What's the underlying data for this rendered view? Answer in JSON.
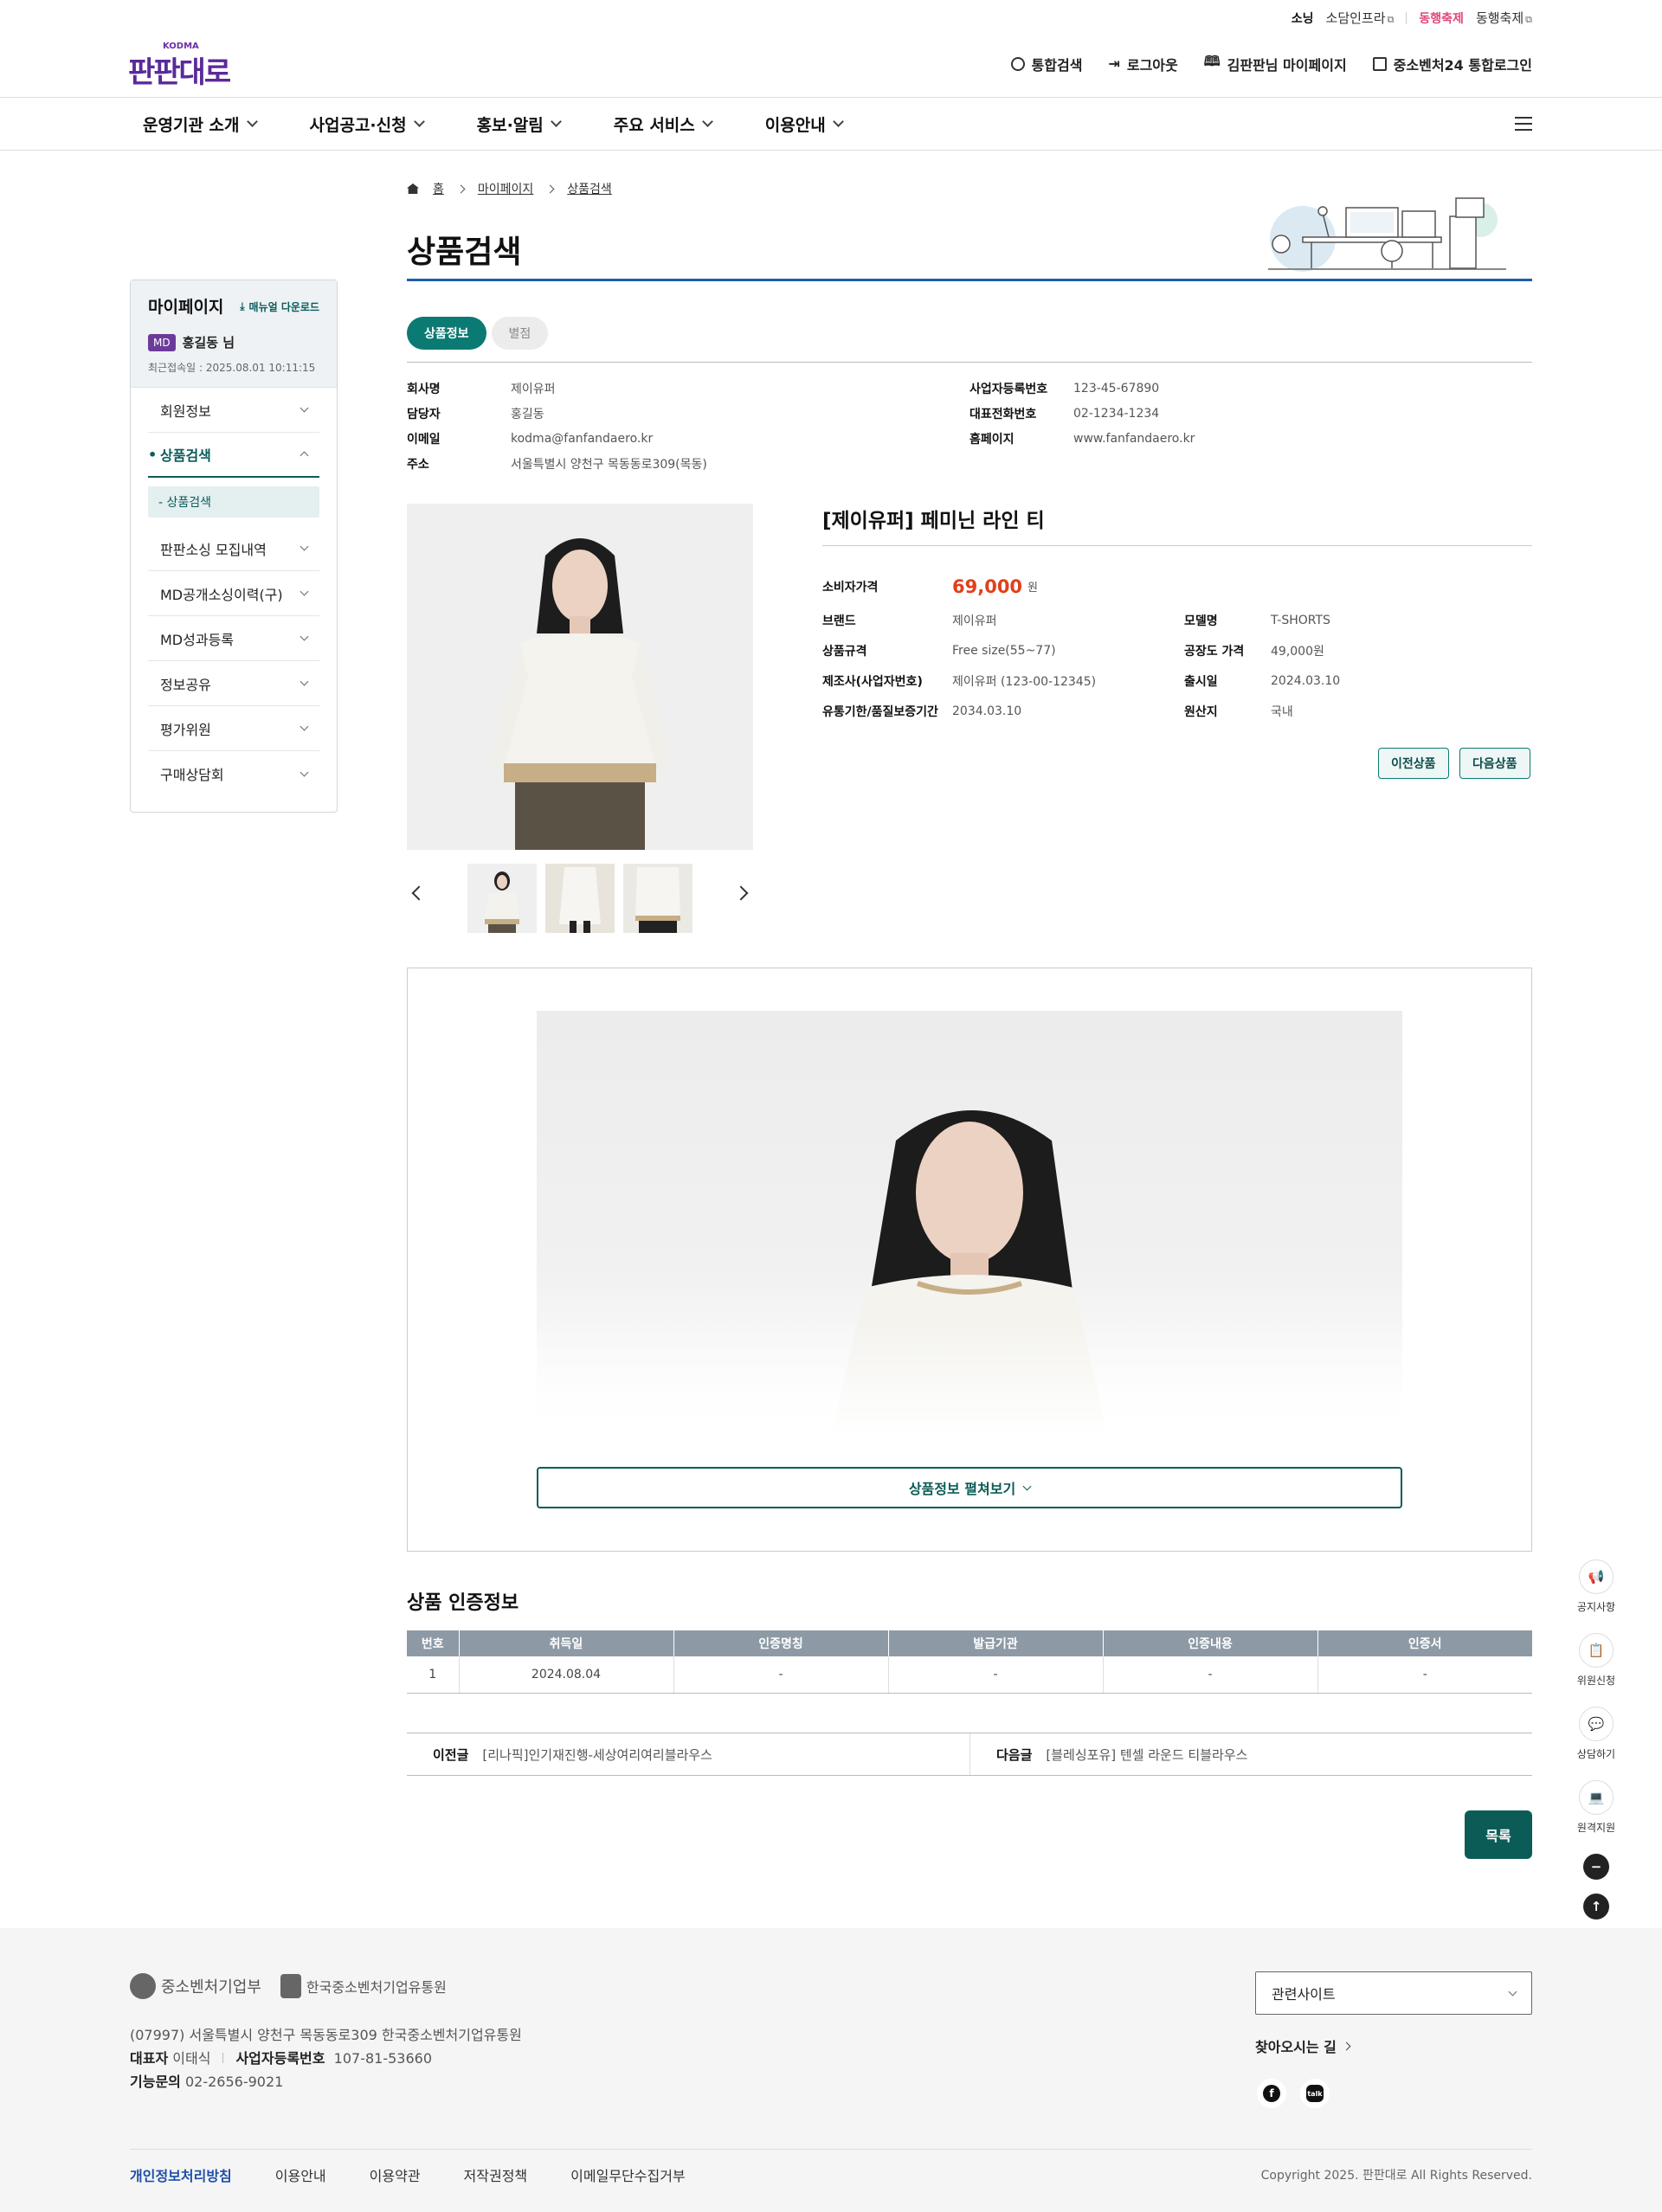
{
  "util_bar": {
    "items": [
      {
        "brand": "소닝",
        "label": "소담인프라"
      },
      {
        "brand": "동행축제",
        "label": "동행축제"
      }
    ]
  },
  "header": {
    "logo_sub": "KODMA",
    "logo_text": "판판대로",
    "util": [
      {
        "icon": "search-icon",
        "label": "통합검색"
      },
      {
        "icon": "logout-icon",
        "label": "로그아웃"
      },
      {
        "icon": "book-icon",
        "label": "김판판님 마이페이지"
      },
      {
        "icon": "doc-icon",
        "label": "중소벤처24 통합로그인"
      }
    ]
  },
  "nav": [
    "운영기관 소개",
    "사업공고·신청",
    "홍보·알림",
    "주요 서비스",
    "이용안내"
  ],
  "sidebar": {
    "title": "마이페이지",
    "manual": "매뉴얼 다운로드",
    "badge": "MD",
    "user": "홍길동 님",
    "last_login": "최근접속일 : 2025.08.01 10:11:15",
    "items": [
      "회원정보",
      "상품검색",
      "판판소싱 모집내역",
      "MD공개소싱이력(구)",
      "MD성과등록",
      "정보공유",
      "평가위원",
      "구매상담회"
    ],
    "sub_item": "- 상품검색"
  },
  "breadcrumb": [
    "홈",
    "마이페이지",
    "상품검색"
  ],
  "page_title": "상품검색",
  "tabs": [
    "상품정보",
    "별점"
  ],
  "company": {
    "left": [
      {
        "k": "회사명",
        "v": "제이유퍼"
      },
      {
        "k": "담당자",
        "v": "홍길동"
      },
      {
        "k": "이메일",
        "v": "kodma@fanfandaero.kr"
      },
      {
        "k": "주소",
        "v": "서울특별시 양천구 목동동로309(목동)"
      }
    ],
    "right": [
      {
        "k": "사업자등록번호",
        "v": "123-45-67890"
      },
      {
        "k": "대표전화번호",
        "v": "02-1234-1234"
      },
      {
        "k": "홈페이지",
        "v": "www.fanfandaero.kr"
      }
    ]
  },
  "product": {
    "name": "[제이유퍼] 페미닌 라인 티",
    "price_label": "소비자가격",
    "price": "69,000",
    "price_unit": "원",
    "specs_left": [
      {
        "k": "브랜드",
        "v": "제이유퍼"
      },
      {
        "k": "상품규격",
        "v": "Free size(55~77)"
      },
      {
        "k": "제조사(사업자번호)",
        "v": "제이유퍼 (123-00-12345)"
      },
      {
        "k": "유통기한/품질보증기간",
        "v": "2034.03.10"
      }
    ],
    "specs_right": [
      {
        "k": "모델명",
        "v": "T-SHORTS"
      },
      {
        "k": "공장도 가격",
        "v": "49,000원"
      },
      {
        "k": "출시일",
        "v": "2024.03.10"
      },
      {
        "k": "원산지",
        "v": "국내"
      }
    ],
    "prev_btn": "이전상품",
    "next_btn": "다음상품"
  },
  "detail_more": "상품정보 펼쳐보기",
  "cert": {
    "title": "상품 인증정보",
    "headers": [
      "번호",
      "취득일",
      "인증명칭",
      "발급기관",
      "인증내용",
      "인증서"
    ],
    "rows": [
      [
        "1",
        "2024.08.04",
        "-",
        "-",
        "-",
        "-"
      ]
    ]
  },
  "prevnext": {
    "prev_label": "이전글",
    "prev_text": "[리나픽]인기재진행-세상여리여리블라우스",
    "next_label": "다음글",
    "next_text": "[블레싱포유] 텐셀 라운드 티블라우스"
  },
  "list_btn": "목록",
  "quick": [
    "공지사항",
    "위원신청",
    "상담하기",
    "원격지원"
  ],
  "footer": {
    "logo1": "중소벤처기업부",
    "logo2": "한국중소벤처기업유통원",
    "address": "(07997) 서울특별시 양천구 목동동로309 한국중소벤처기업유통원",
    "ceo_label": "대표자",
    "ceo": "이태식",
    "biz_label": "사업자등록번호",
    "biz": "107-81-53660",
    "tel_label": "기능문의",
    "tel": "02-2656-9021",
    "related": "관련사이트",
    "way": "찾아오시는 길",
    "links": [
      "개인정보처리방침",
      "이용안내",
      "이용약관",
      "저작권정책",
      "이메일무단수집거부"
    ],
    "copyright": "Copyright 2025. 판판대로 All Rights Reserved."
  },
  "colors": {
    "primary": "#0b5c57",
    "tab_on": "#0b7a73",
    "price": "#e0401a",
    "title_line": "#1f5ea8",
    "logo": "#5a2a9a"
  }
}
